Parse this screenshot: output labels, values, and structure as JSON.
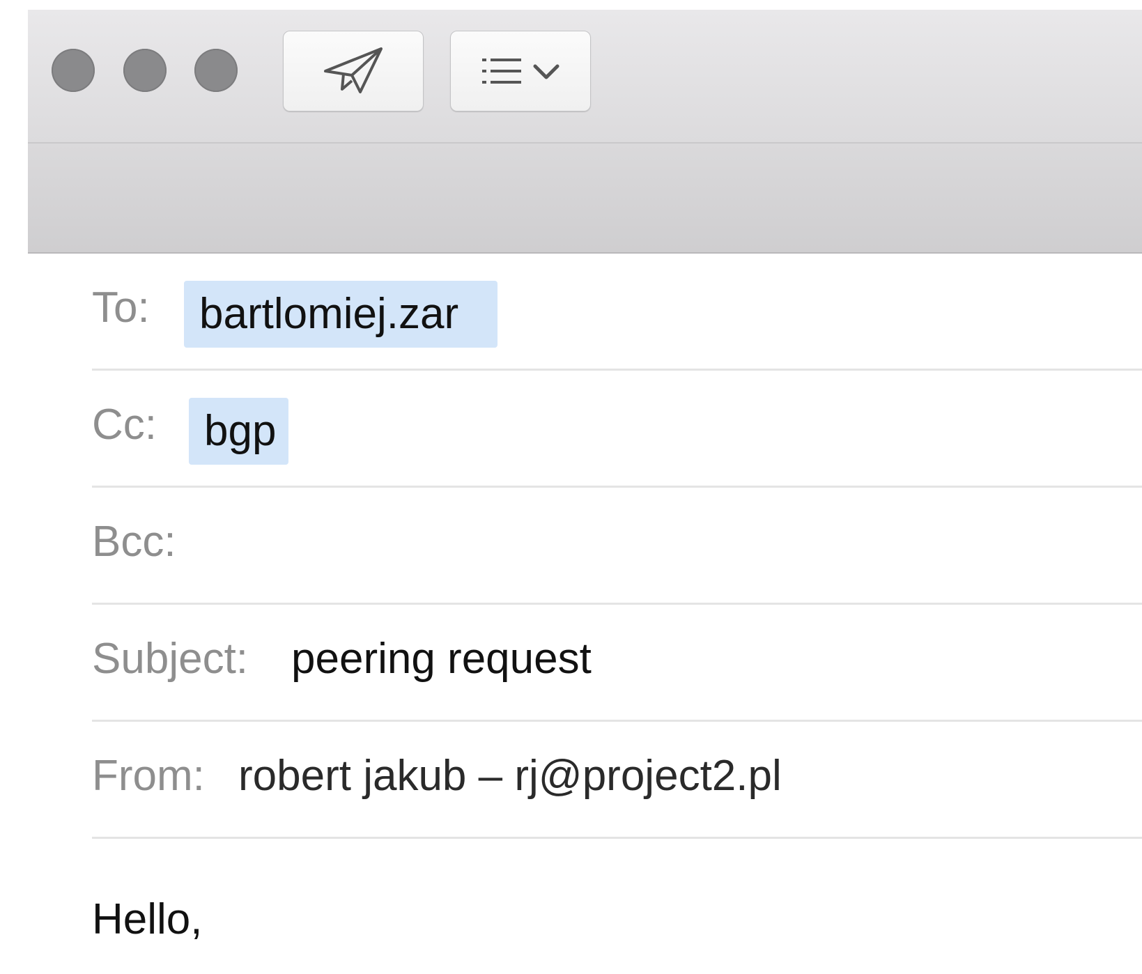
{
  "toolbar": {
    "window_controls": [
      "close",
      "minimize",
      "zoom"
    ],
    "send_icon": "paper-plane-icon",
    "format_icon": "list-format-icon",
    "dropdown_icon": "chevron-down-icon"
  },
  "fields": {
    "to": {
      "label": "To:",
      "value": "bartlomiej.zar"
    },
    "cc": {
      "label": "Cc:",
      "value": "bgp"
    },
    "bcc": {
      "label": "Bcc:",
      "value": ""
    },
    "subject": {
      "label": "Subject:",
      "value": "peering request"
    },
    "from": {
      "label": "From:",
      "value": "robert jakub – rj@project2.pl"
    }
  },
  "body": {
    "first_line": "Hello,"
  },
  "colors": {
    "token_bg": "#d3e5f9",
    "label": "#8e8e8e",
    "traffic_light": "#8a8a8c"
  }
}
